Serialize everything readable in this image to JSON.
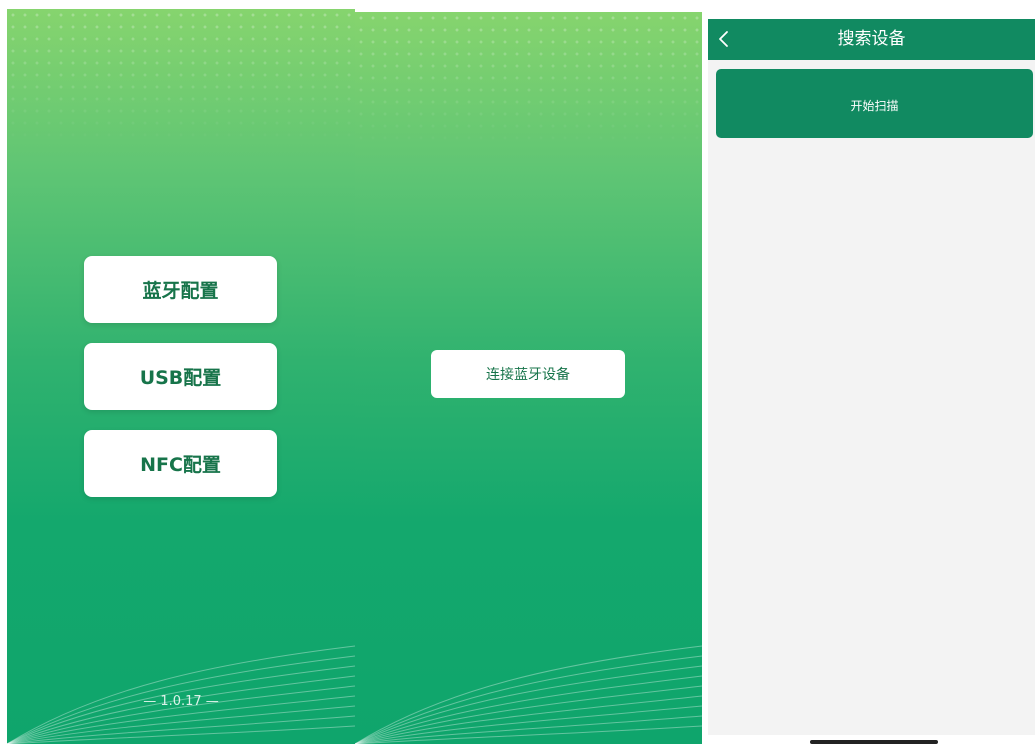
{
  "screen1": {
    "buttons": [
      {
        "label": "蓝牙配置"
      },
      {
        "label": "USB配置"
      },
      {
        "label": "NFC配置"
      }
    ],
    "version": "— 1.0.17 —"
  },
  "screen2": {
    "connect_label": "连接蓝牙设备"
  },
  "screen3": {
    "title": "搜索设备",
    "scan_label": "开始扫描",
    "back_icon": "chevron-left-icon"
  },
  "colors": {
    "brand_green": "#118a61",
    "button_text_green": "#17744a",
    "gradient_top": "#86d46e",
    "gradient_bottom": "#0fa56c",
    "page_bg": "#f3f3f3"
  }
}
